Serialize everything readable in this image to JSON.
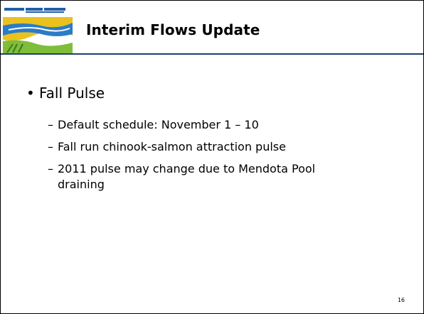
{
  "header": {
    "title": "Interim Flows Update",
    "logo_icon": "san-joaquin-river-logo-icon",
    "rule_color": "#1f3f6e"
  },
  "body": {
    "bullet": "Fall Pulse",
    "subitems": [
      "Default schedule: November 1 – 10",
      "Fall run chinook-salmon attraction pulse",
      "2011 pulse may change due to Mendota Pool",
      "draining"
    ]
  },
  "footer": {
    "page_number": "16"
  }
}
